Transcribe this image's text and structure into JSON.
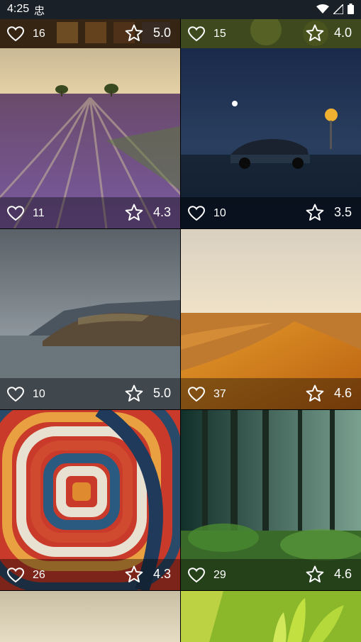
{
  "status_bar": {
    "time": "4:25",
    "notification_glyph": "忠"
  },
  "tiles": [
    {
      "likes": "16",
      "rating": "5.0"
    },
    {
      "likes": "15",
      "rating": "4.0"
    },
    {
      "likes": "11",
      "rating": "4.3"
    },
    {
      "likes": "10",
      "rating": "3.5"
    },
    {
      "likes": "10",
      "rating": "5.0"
    },
    {
      "likes": "37",
      "rating": "4.6"
    },
    {
      "likes": "26",
      "rating": "4.3"
    },
    {
      "likes": "29",
      "rating": "4.6"
    }
  ],
  "icons": {
    "like": "heart-outline-icon",
    "rate": "star-outline-icon"
  }
}
